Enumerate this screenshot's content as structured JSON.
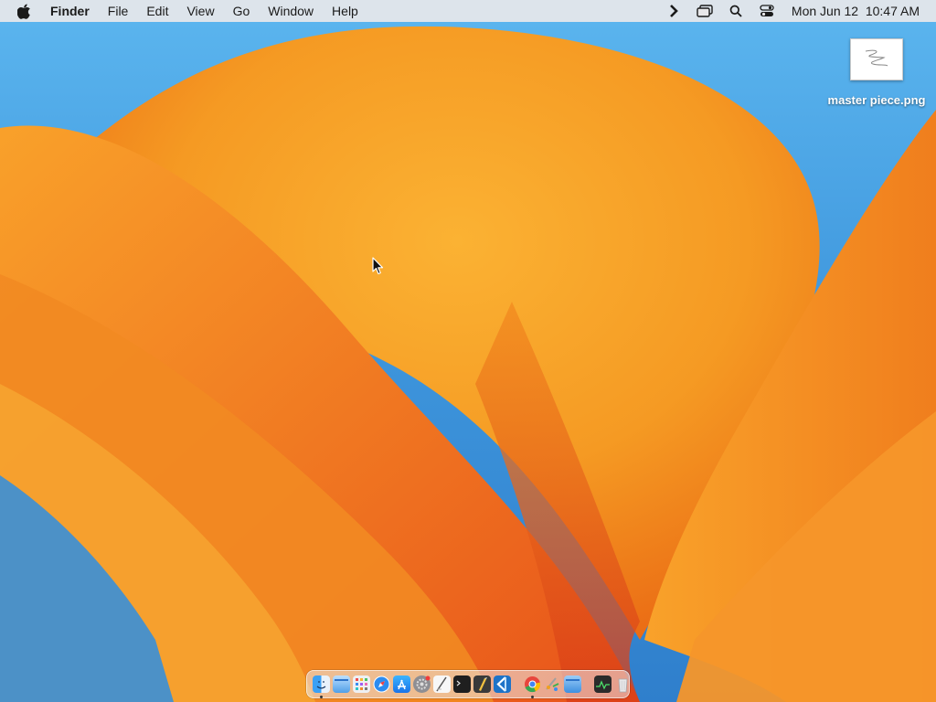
{
  "menubar": {
    "apple_icon": "apple-logo-icon",
    "app_name": "Finder",
    "menus": [
      "File",
      "Edit",
      "View",
      "Go",
      "Window",
      "Help"
    ],
    "status_icons": [
      "chevron-right-icon",
      "screen-mirroring-icon",
      "spotlight-search-icon",
      "control-center-icon"
    ],
    "clock": "Mon Jun 12  10:47 AM"
  },
  "desktop": {
    "files": [
      {
        "name": "master piece.png",
        "icon": "image-file-icon"
      }
    ]
  },
  "dock": {
    "apps": [
      {
        "name": "Finder",
        "icon": "finder-icon",
        "running": true
      },
      {
        "name": "Files",
        "icon": "folder-window-icon",
        "running": false
      },
      {
        "name": "Launchpad",
        "icon": "launchpad-icon",
        "running": false
      },
      {
        "name": "Safari",
        "icon": "safari-compass-icon",
        "running": false
      },
      {
        "name": "App Store",
        "icon": "app-store-icon",
        "running": false
      },
      {
        "name": "System Settings",
        "icon": "gear-icon",
        "running": false
      },
      {
        "name": "TextEdit",
        "icon": "text-edit-icon",
        "running": false
      },
      {
        "name": "Terminal",
        "icon": "terminal-icon",
        "running": false
      },
      {
        "name": "Script Editor",
        "icon": "script-editor-icon",
        "running": false
      },
      {
        "name": "Visual Studio Code",
        "icon": "vscode-icon",
        "running": false
      },
      {
        "name": "Google Chrome",
        "icon": "chrome-icon",
        "running": true
      },
      {
        "name": "Paintbrush",
        "icon": "paintbrush-icon",
        "running": false
      },
      {
        "name": "Downloads",
        "icon": "downloads-folder-icon",
        "running": false
      },
      {
        "name": "Activity Monitor",
        "icon": "activity-monitor-icon",
        "running": false
      },
      {
        "name": "Trash",
        "icon": "trash-icon",
        "running": false
      }
    ]
  },
  "colors": {
    "menubar_bg": "#e8e8ea",
    "wallpaper_orange": "#f7931e",
    "wallpaper_blue": "#3f97dd"
  }
}
